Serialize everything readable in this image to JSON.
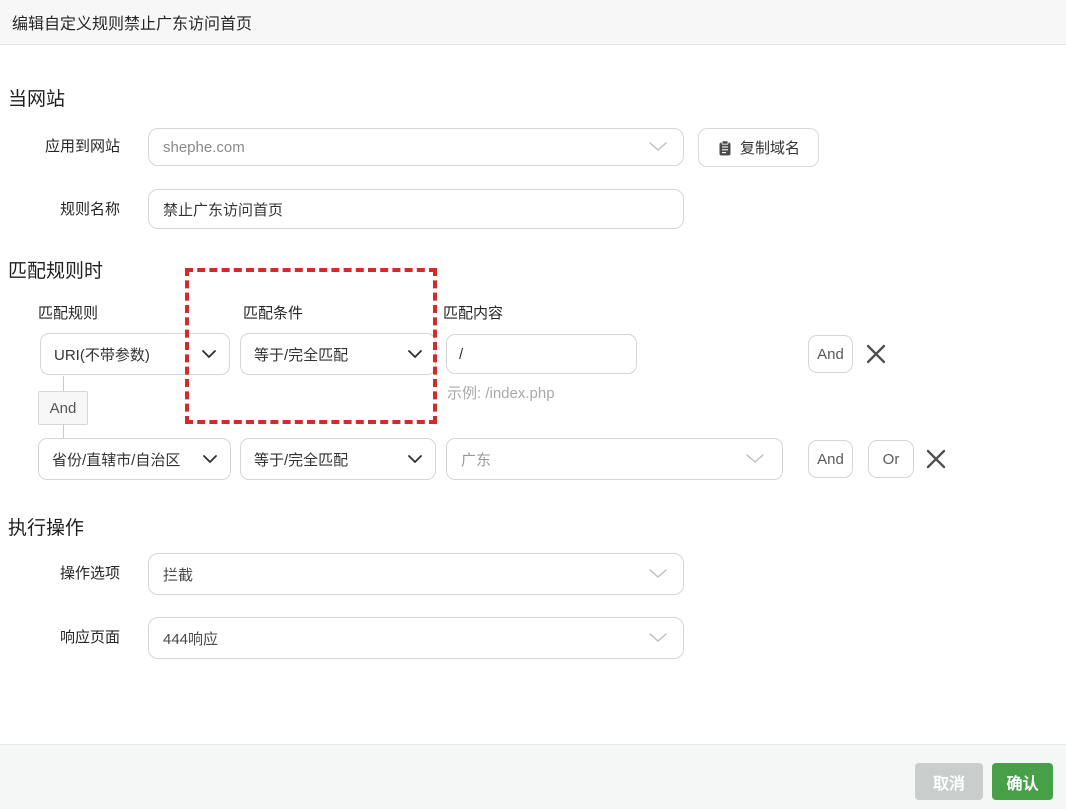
{
  "header": {
    "title": "编辑自定义规则禁止广东访问首页"
  },
  "site_section": {
    "heading": "当网站",
    "apply": {
      "label": "应用到网站",
      "value": "shephe.com"
    },
    "copy_domain_button": "复制域名",
    "rule_name": {
      "label": "规则名称",
      "value": "禁止广东访问首页"
    }
  },
  "match_section": {
    "heading": "匹配规则时",
    "columns": {
      "rule": "匹配规则",
      "condition": "匹配条件",
      "content": "匹配内容"
    },
    "row1": {
      "rule": "URI(不带参数)",
      "condition": "等于/完全匹配",
      "content": "/",
      "hint": "示例: /index.php",
      "and_button": "And"
    },
    "connector": "And",
    "row2": {
      "rule": "省份/直辖市/自治区",
      "condition": "等于/完全匹配",
      "content": "广东",
      "and_button": "And",
      "or_button": "Or"
    }
  },
  "action_section": {
    "heading": "执行操作",
    "option": {
      "label": "操作选项",
      "value": "拦截"
    },
    "response_page": {
      "label": "响应页面",
      "value": "444响应"
    }
  },
  "footer": {
    "cancel_button": "取消",
    "confirm_button": "确认"
  },
  "colors": {
    "annotation_red": "#d12b2b",
    "confirm_green": "#47a047",
    "cancel_gray": "#c9cdcc"
  }
}
